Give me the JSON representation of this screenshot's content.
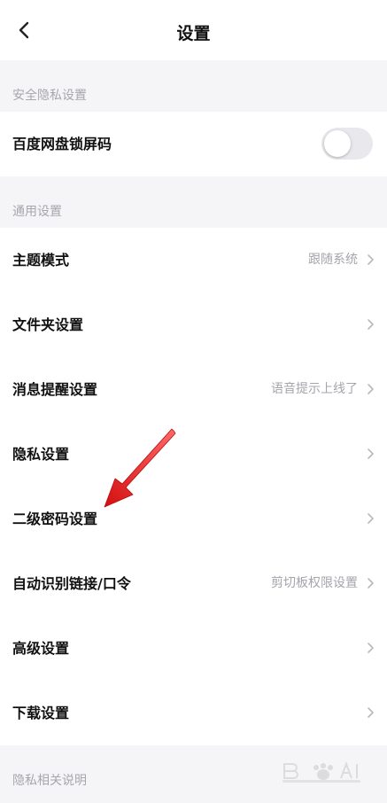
{
  "header": {
    "title": "设置"
  },
  "sections": {
    "security": {
      "title": "安全隐私设置",
      "items": [
        {
          "label": "百度网盘锁屏码",
          "toggle_on": false
        }
      ]
    },
    "general": {
      "title": "通用设置",
      "items": [
        {
          "label": "主题模式",
          "value": "跟随系统"
        },
        {
          "label": "文件夹设置",
          "value": ""
        },
        {
          "label": "消息提醒设置",
          "value": "语音提示上线了"
        },
        {
          "label": "隐私设置",
          "value": ""
        },
        {
          "label": "二级密码设置",
          "value": ""
        },
        {
          "label": "自动识别链接/口令",
          "value": "剪切板权限设置"
        },
        {
          "label": "高级设置",
          "value": ""
        },
        {
          "label": "下载设置",
          "value": ""
        }
      ]
    },
    "privacy_notes": {
      "title": "隐私相关说明"
    }
  },
  "colors": {
    "background": "#f5f5f7",
    "card": "#ffffff",
    "annotation_arrow": "#e21818"
  }
}
